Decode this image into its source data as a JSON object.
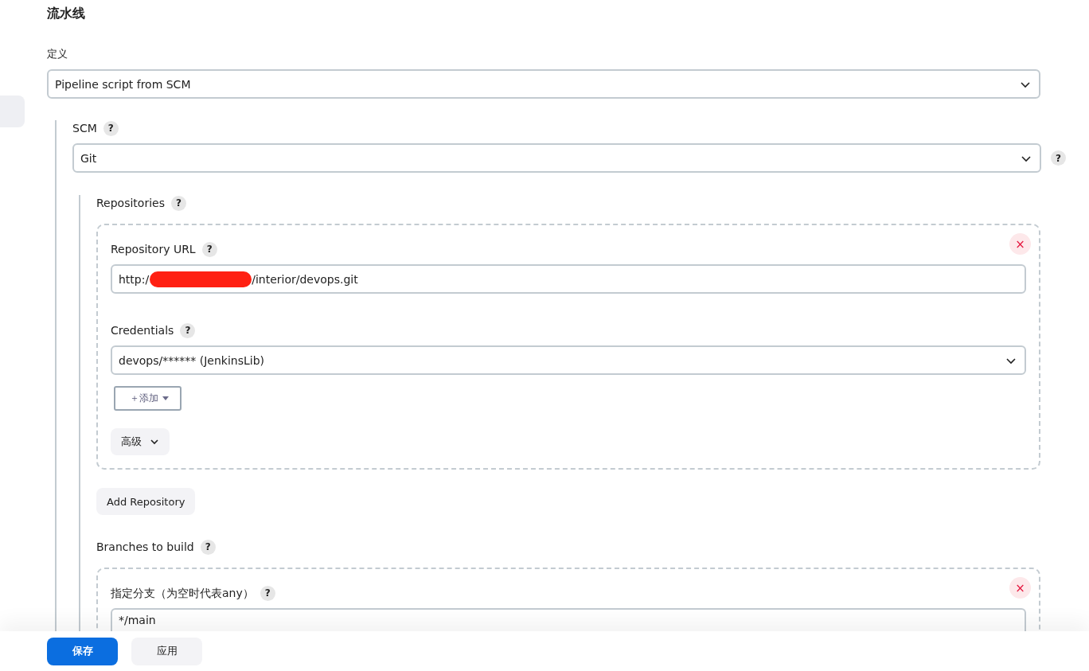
{
  "section_title": "流水线",
  "definition": {
    "label": "定义",
    "value": "Pipeline script from SCM"
  },
  "scm": {
    "label": "SCM",
    "help": "?",
    "value": "Git",
    "side_help": "?"
  },
  "repositories": {
    "label": "Repositories",
    "help": "?",
    "delete": "×",
    "url": {
      "label": "Repository URL",
      "help": "?",
      "prefix": "http:/",
      "suffix": "/interior/devops.git"
    },
    "credentials": {
      "label": "Credentials",
      "help": "?",
      "value": "devops/****** (JenkinsLib)"
    },
    "add_button": "＋添加",
    "advanced_button": "高级",
    "add_repository": "Add Repository"
  },
  "branches": {
    "label": "Branches to build",
    "help": "?",
    "delete": "×",
    "field_label": "指定分支（为空时代表any）",
    "field_help": "?",
    "value": "*/main"
  },
  "buttons": [
    {
      "label": "保存",
      "kind": "primary"
    },
    {
      "label": "应用",
      "kind": "secondary"
    }
  ]
}
